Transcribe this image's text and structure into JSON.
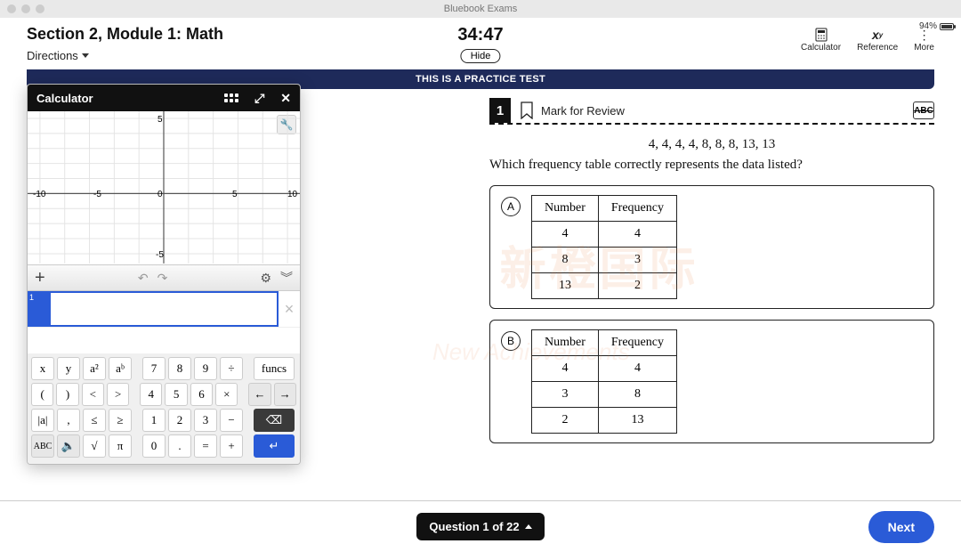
{
  "window": {
    "title": "Bluebook Exams",
    "battery": "94%"
  },
  "header": {
    "section": "Section 2, Module 1: Math",
    "directions": "Directions",
    "timer": "34:47",
    "hide": "Hide",
    "tools": {
      "calc": "Calculator",
      "ref": "Reference",
      "more": "More"
    }
  },
  "banner": "THIS IS A PRACTICE TEST",
  "calc": {
    "title": "Calculator",
    "axis": {
      "xmin": "-10",
      "xneg": "-5",
      "zero": "0",
      "xpos": "5",
      "xmax": "10",
      "ypos": "5",
      "yneg": "-5"
    },
    "keys": {
      "x": "x",
      "y": "y",
      "a2": "a²",
      "ab": "aᵇ",
      "lp": "(",
      "rp": ")",
      "lt": "<",
      "gt": ">",
      "abs": "|a|",
      "comma": ",",
      "le": "≤",
      "ge": "≥",
      "abc": "ABC",
      "snd": "🔈",
      "sqrt": "√",
      "pi": "π",
      "n7": "7",
      "n8": "8",
      "n9": "9",
      "div": "÷",
      "funcs": "funcs",
      "n4": "4",
      "n5": "5",
      "n6": "6",
      "mul": "×",
      "n1": "1",
      "n2": "2",
      "n3": "3",
      "min": "−",
      "n0": "0",
      "dot": ".",
      "eq": "=",
      "plus": "+",
      "left": "←",
      "right": "→",
      "bsp": "⌫",
      "enter": "↵"
    }
  },
  "question": {
    "number": "1",
    "mark": "Mark for Review",
    "strike": "ABC",
    "data": "4, 4, 4, 4, 8, 8, 8, 13, 13",
    "prompt": "Which frequency table correctly represents the data listed?",
    "choiceA": {
      "letter": "A",
      "h1": "Number",
      "h2": "Frequency",
      "rows": [
        [
          "4",
          "4"
        ],
        [
          "8",
          "3"
        ],
        [
          "13",
          "2"
        ]
      ]
    },
    "choiceB": {
      "letter": "B",
      "h1": "Number",
      "h2": "Frequency",
      "rows": [
        [
          "4",
          "4"
        ],
        [
          "3",
          "8"
        ],
        [
          "2",
          "13"
        ]
      ]
    }
  },
  "footer": {
    "nav": "Question 1 of 22",
    "next": "Next"
  },
  "watermark": {
    "main": "新橙国际",
    "sub": "New Achievements"
  }
}
